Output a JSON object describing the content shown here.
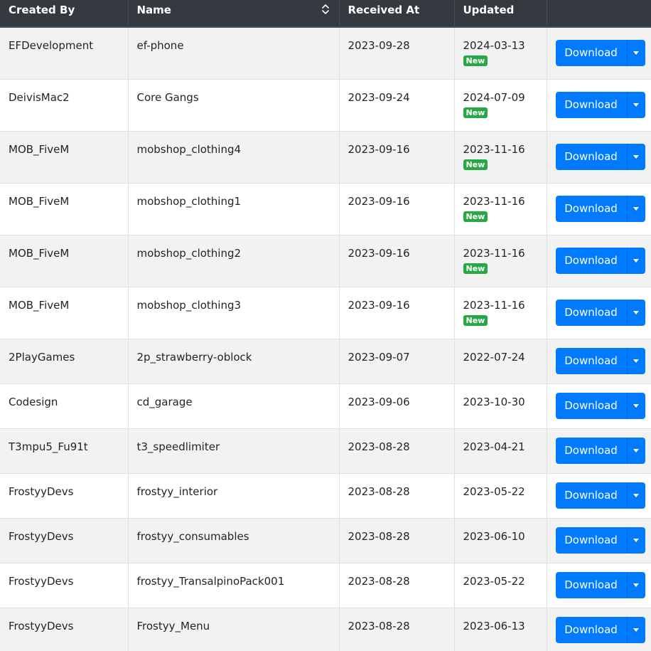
{
  "table": {
    "headers": [
      "Created By",
      "Name",
      "Received At",
      "Updated",
      ""
    ],
    "download_label": "Download",
    "badge_label": "New",
    "rows": [
      {
        "created_by": "EFDevelopment",
        "name": "ef-phone",
        "received": "2023-09-28",
        "updated": "2024-03-13",
        "new": true
      },
      {
        "created_by": "DeivisMac2",
        "name": "Core Gangs",
        "received": "2023-09-24",
        "updated": "2024-07-09",
        "new": true
      },
      {
        "created_by": "MOB_FiveM",
        "name": "mobshop_clothing4",
        "received": "2023-09-16",
        "updated": "2023-11-16",
        "new": true
      },
      {
        "created_by": "MOB_FiveM",
        "name": "mobshop_clothing1",
        "received": "2023-09-16",
        "updated": "2023-11-16",
        "new": true
      },
      {
        "created_by": "MOB_FiveM",
        "name": "mobshop_clothing2",
        "received": "2023-09-16",
        "updated": "2023-11-16",
        "new": true
      },
      {
        "created_by": "MOB_FiveM",
        "name": "mobshop_clothing3",
        "received": "2023-09-16",
        "updated": "2023-11-16",
        "new": true
      },
      {
        "created_by": "2PlayGames",
        "name": "2p_strawberry-oblock",
        "received": "2023-09-07",
        "updated": "2022-07-24",
        "new": false
      },
      {
        "created_by": "Codesign",
        "name": "cd_garage",
        "received": "2023-09-06",
        "updated": "2023-10-30",
        "new": false
      },
      {
        "created_by": "T3mpu5_Fu91t",
        "name": "t3_speedlimiter",
        "received": "2023-08-28",
        "updated": "2023-04-21",
        "new": false
      },
      {
        "created_by": "FrostyyDevs",
        "name": "frostyy_interior",
        "received": "2023-08-28",
        "updated": "2023-05-22",
        "new": false
      },
      {
        "created_by": "FrostyyDevs",
        "name": "frostyy_consumables",
        "received": "2023-08-28",
        "updated": "2023-06-10",
        "new": false
      },
      {
        "created_by": "FrostyyDevs",
        "name": "frostyy_TransalpinoPack001",
        "received": "2023-08-28",
        "updated": "2023-05-22",
        "new": false
      },
      {
        "created_by": "FrostyyDevs",
        "name": "Frostyy_Menu",
        "received": "2023-08-28",
        "updated": "2023-06-13",
        "new": false
      }
    ]
  },
  "colors": {
    "header_bg": "#343a40",
    "primary": "#007bff",
    "success": "#28a745"
  }
}
